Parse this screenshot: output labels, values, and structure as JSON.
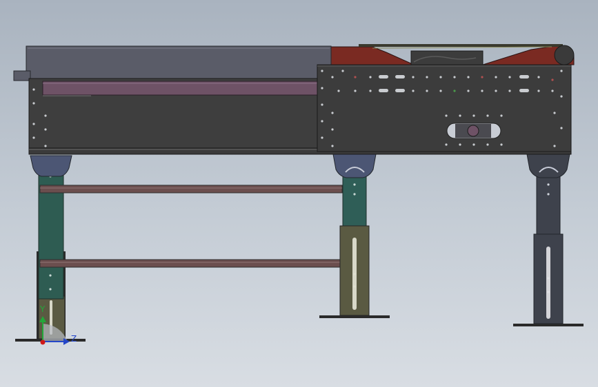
{
  "viewport": {
    "background_top": "#a9b3bf",
    "background_bottom": "#d8dde3"
  },
  "model": {
    "frame_color": "#3e3e3e",
    "cover_color": "#5a5c68",
    "belt_color": "#6e5266",
    "drive_guard_color": "#7a2a22",
    "leg_left_color": "#2e5c52",
    "leg_mid_color": "#2f5e57",
    "leg_right_color": "#3e424c",
    "leg_foot_color": "#5a5a42",
    "brace_color": "#6b4e4e"
  },
  "triad": {
    "y_label": "Y",
    "z_label": "Z",
    "y_color": "#22a83a",
    "z_color": "#2546c8",
    "origin_color": "#d01818"
  }
}
